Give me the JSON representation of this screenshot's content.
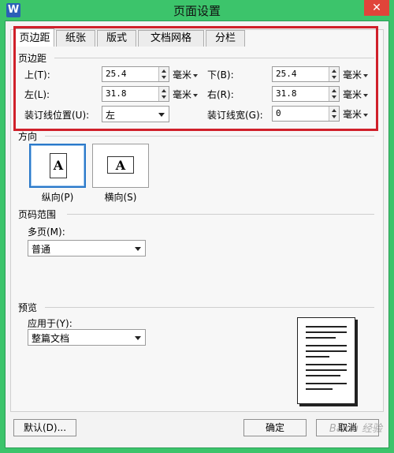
{
  "window": {
    "title": "页面设置",
    "app_icon": "W",
    "close": "✕"
  },
  "tabs": [
    "页边距",
    "纸张",
    "版式",
    "文档网格",
    "分栏"
  ],
  "margins": {
    "section_title": "页边距",
    "top": {
      "label": "上(T):",
      "value": "25.4",
      "unit": "毫米"
    },
    "bottom": {
      "label": "下(B):",
      "value": "25.4",
      "unit": "毫米"
    },
    "left": {
      "label": "左(L):",
      "value": "31.8",
      "unit": "毫米"
    },
    "right": {
      "label": "右(R):",
      "value": "31.8",
      "unit": "毫米"
    },
    "gutter_position": {
      "label": "装订线位置(U):",
      "value": "左"
    },
    "gutter_width": {
      "label": "装订线宽(G):",
      "value": "0",
      "unit": "毫米"
    }
  },
  "orientation": {
    "section_title": "方向",
    "portrait": {
      "label": "纵向(P)",
      "glyph": "A"
    },
    "landscape": {
      "label": "横向(S)",
      "glyph": "A"
    },
    "selected": "portrait"
  },
  "page_range": {
    "section_title": "页码范围",
    "multi_label": "多页(M):",
    "multi_value": "普通"
  },
  "preview": {
    "section_title": "预览",
    "apply_label": "应用于(Y):",
    "apply_value": "整篇文档"
  },
  "buttons": {
    "default": "默认(D)...",
    "ok": "确定",
    "cancel": "取消"
  },
  "watermark": "Baidu 经验",
  "colors": {
    "title_bar": "#3cc46b",
    "highlight": "#d0202a",
    "selected": "#2b79c9"
  }
}
